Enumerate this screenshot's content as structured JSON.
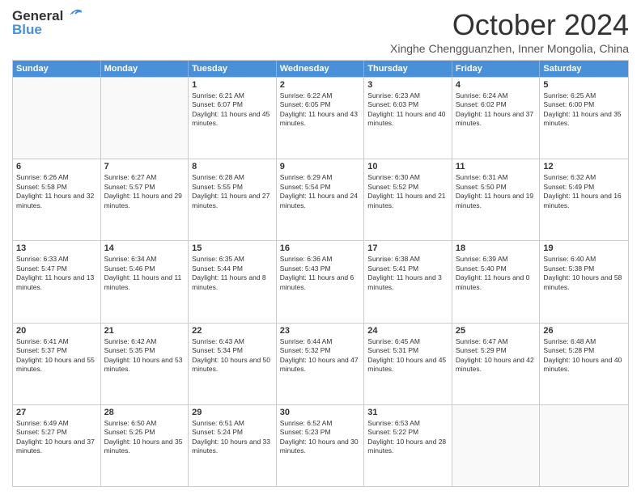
{
  "logo": {
    "general": "General",
    "blue": "Blue"
  },
  "header": {
    "month": "October 2024",
    "location": "Xinghe Chengguanzhen, Inner Mongolia, China"
  },
  "days": [
    "Sunday",
    "Monday",
    "Tuesday",
    "Wednesday",
    "Thursday",
    "Friday",
    "Saturday"
  ],
  "weeks": [
    [
      {
        "day": "",
        "empty": true
      },
      {
        "day": "",
        "empty": true
      },
      {
        "day": "1",
        "sunrise": "Sunrise: 6:21 AM",
        "sunset": "Sunset: 6:07 PM",
        "daylight": "Daylight: 11 hours and 45 minutes."
      },
      {
        "day": "2",
        "sunrise": "Sunrise: 6:22 AM",
        "sunset": "Sunset: 6:05 PM",
        "daylight": "Daylight: 11 hours and 43 minutes."
      },
      {
        "day": "3",
        "sunrise": "Sunrise: 6:23 AM",
        "sunset": "Sunset: 6:03 PM",
        "daylight": "Daylight: 11 hours and 40 minutes."
      },
      {
        "day": "4",
        "sunrise": "Sunrise: 6:24 AM",
        "sunset": "Sunset: 6:02 PM",
        "daylight": "Daylight: 11 hours and 37 minutes."
      },
      {
        "day": "5",
        "sunrise": "Sunrise: 6:25 AM",
        "sunset": "Sunset: 6:00 PM",
        "daylight": "Daylight: 11 hours and 35 minutes."
      }
    ],
    [
      {
        "day": "6",
        "sunrise": "Sunrise: 6:26 AM",
        "sunset": "Sunset: 5:58 PM",
        "daylight": "Daylight: 11 hours and 32 minutes."
      },
      {
        "day": "7",
        "sunrise": "Sunrise: 6:27 AM",
        "sunset": "Sunset: 5:57 PM",
        "daylight": "Daylight: 11 hours and 29 minutes."
      },
      {
        "day": "8",
        "sunrise": "Sunrise: 6:28 AM",
        "sunset": "Sunset: 5:55 PM",
        "daylight": "Daylight: 11 hours and 27 minutes."
      },
      {
        "day": "9",
        "sunrise": "Sunrise: 6:29 AM",
        "sunset": "Sunset: 5:54 PM",
        "daylight": "Daylight: 11 hours and 24 minutes."
      },
      {
        "day": "10",
        "sunrise": "Sunrise: 6:30 AM",
        "sunset": "Sunset: 5:52 PM",
        "daylight": "Daylight: 11 hours and 21 minutes."
      },
      {
        "day": "11",
        "sunrise": "Sunrise: 6:31 AM",
        "sunset": "Sunset: 5:50 PM",
        "daylight": "Daylight: 11 hours and 19 minutes."
      },
      {
        "day": "12",
        "sunrise": "Sunrise: 6:32 AM",
        "sunset": "Sunset: 5:49 PM",
        "daylight": "Daylight: 11 hours and 16 minutes."
      }
    ],
    [
      {
        "day": "13",
        "sunrise": "Sunrise: 6:33 AM",
        "sunset": "Sunset: 5:47 PM",
        "daylight": "Daylight: 11 hours and 13 minutes."
      },
      {
        "day": "14",
        "sunrise": "Sunrise: 6:34 AM",
        "sunset": "Sunset: 5:46 PM",
        "daylight": "Daylight: 11 hours and 11 minutes."
      },
      {
        "day": "15",
        "sunrise": "Sunrise: 6:35 AM",
        "sunset": "Sunset: 5:44 PM",
        "daylight": "Daylight: 11 hours and 8 minutes."
      },
      {
        "day": "16",
        "sunrise": "Sunrise: 6:36 AM",
        "sunset": "Sunset: 5:43 PM",
        "daylight": "Daylight: 11 hours and 6 minutes."
      },
      {
        "day": "17",
        "sunrise": "Sunrise: 6:38 AM",
        "sunset": "Sunset: 5:41 PM",
        "daylight": "Daylight: 11 hours and 3 minutes."
      },
      {
        "day": "18",
        "sunrise": "Sunrise: 6:39 AM",
        "sunset": "Sunset: 5:40 PM",
        "daylight": "Daylight: 11 hours and 0 minutes."
      },
      {
        "day": "19",
        "sunrise": "Sunrise: 6:40 AM",
        "sunset": "Sunset: 5:38 PM",
        "daylight": "Daylight: 10 hours and 58 minutes."
      }
    ],
    [
      {
        "day": "20",
        "sunrise": "Sunrise: 6:41 AM",
        "sunset": "Sunset: 5:37 PM",
        "daylight": "Daylight: 10 hours and 55 minutes."
      },
      {
        "day": "21",
        "sunrise": "Sunrise: 6:42 AM",
        "sunset": "Sunset: 5:35 PM",
        "daylight": "Daylight: 10 hours and 53 minutes."
      },
      {
        "day": "22",
        "sunrise": "Sunrise: 6:43 AM",
        "sunset": "Sunset: 5:34 PM",
        "daylight": "Daylight: 10 hours and 50 minutes."
      },
      {
        "day": "23",
        "sunrise": "Sunrise: 6:44 AM",
        "sunset": "Sunset: 5:32 PM",
        "daylight": "Daylight: 10 hours and 47 minutes."
      },
      {
        "day": "24",
        "sunrise": "Sunrise: 6:45 AM",
        "sunset": "Sunset: 5:31 PM",
        "daylight": "Daylight: 10 hours and 45 minutes."
      },
      {
        "day": "25",
        "sunrise": "Sunrise: 6:47 AM",
        "sunset": "Sunset: 5:29 PM",
        "daylight": "Daylight: 10 hours and 42 minutes."
      },
      {
        "day": "26",
        "sunrise": "Sunrise: 6:48 AM",
        "sunset": "Sunset: 5:28 PM",
        "daylight": "Daylight: 10 hours and 40 minutes."
      }
    ],
    [
      {
        "day": "27",
        "sunrise": "Sunrise: 6:49 AM",
        "sunset": "Sunset: 5:27 PM",
        "daylight": "Daylight: 10 hours and 37 minutes."
      },
      {
        "day": "28",
        "sunrise": "Sunrise: 6:50 AM",
        "sunset": "Sunset: 5:25 PM",
        "daylight": "Daylight: 10 hours and 35 minutes."
      },
      {
        "day": "29",
        "sunrise": "Sunrise: 6:51 AM",
        "sunset": "Sunset: 5:24 PM",
        "daylight": "Daylight: 10 hours and 33 minutes."
      },
      {
        "day": "30",
        "sunrise": "Sunrise: 6:52 AM",
        "sunset": "Sunset: 5:23 PM",
        "daylight": "Daylight: 10 hours and 30 minutes."
      },
      {
        "day": "31",
        "sunrise": "Sunrise: 6:53 AM",
        "sunset": "Sunset: 5:22 PM",
        "daylight": "Daylight: 10 hours and 28 minutes."
      },
      {
        "day": "",
        "empty": true
      },
      {
        "day": "",
        "empty": true
      }
    ]
  ]
}
